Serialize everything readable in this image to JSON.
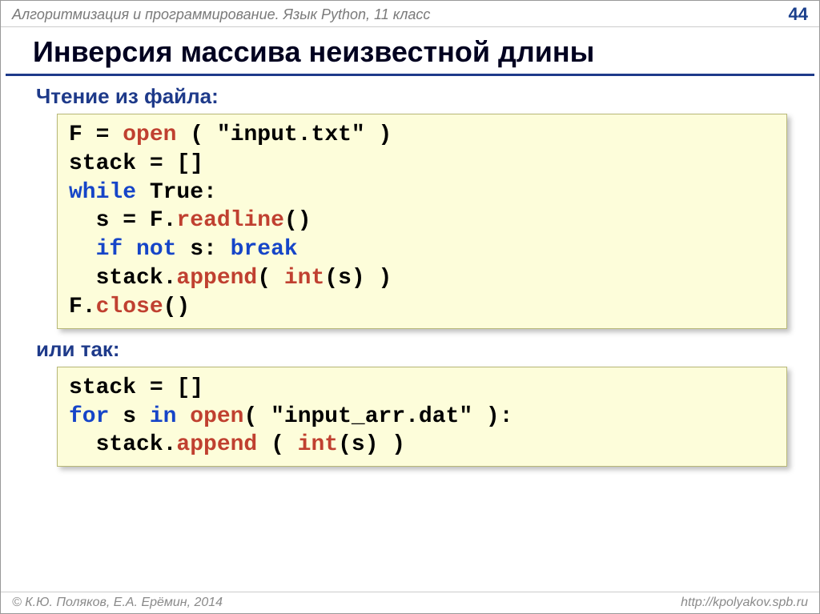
{
  "header": {
    "course": "Алгоритмизация и программирование. Язык Python, 11 класс",
    "page": "44"
  },
  "title": "Инверсия массива неизвестной длины",
  "section1_label": "Чтение из файла:",
  "code1": {
    "l1a": "F",
    "l1b": "=",
    "l1_open": "open",
    "l1c": "(",
    "l1d": " \"input.txt\" )",
    "l2": "stack",
    "l2b": "=",
    "l2c": "[]",
    "l3_while": "while",
    "l3a": " True:",
    "l4a": "  s",
    "l4b": "=",
    "l4c": "F.",
    "l4_read": "readline",
    "l4d": "()",
    "l5a": "  ",
    "l5_if": "if",
    "l5b": " ",
    "l5_not": "not",
    "l5c": " s: ",
    "l5_break": "break",
    "l6a": "  stack.",
    "l6_app": "append",
    "l6b": "( ",
    "l6_int": "int",
    "l6c": "(s) )",
    "l7a": "F.",
    "l7_close": "close",
    "l7b": "()"
  },
  "section2_label": "или так:",
  "code2": {
    "l1": "stack",
    "l1b": "=",
    "l1c": "[]",
    "l2_for": "for",
    "l2a": " s ",
    "l2_in": "in",
    "l2b": " ",
    "l2_open": "open",
    "l2c": "( \"input_arr.dat\" ):",
    "l3a": "  stack.",
    "l3_app": "append",
    "l3b": "( ",
    "l3_int": "int",
    "l3c": "(s) )"
  },
  "footer": {
    "left": "© К.Ю. Поляков, Е.А. Ерёмин, 2014",
    "right": "http://kpolyakov.spb.ru"
  }
}
